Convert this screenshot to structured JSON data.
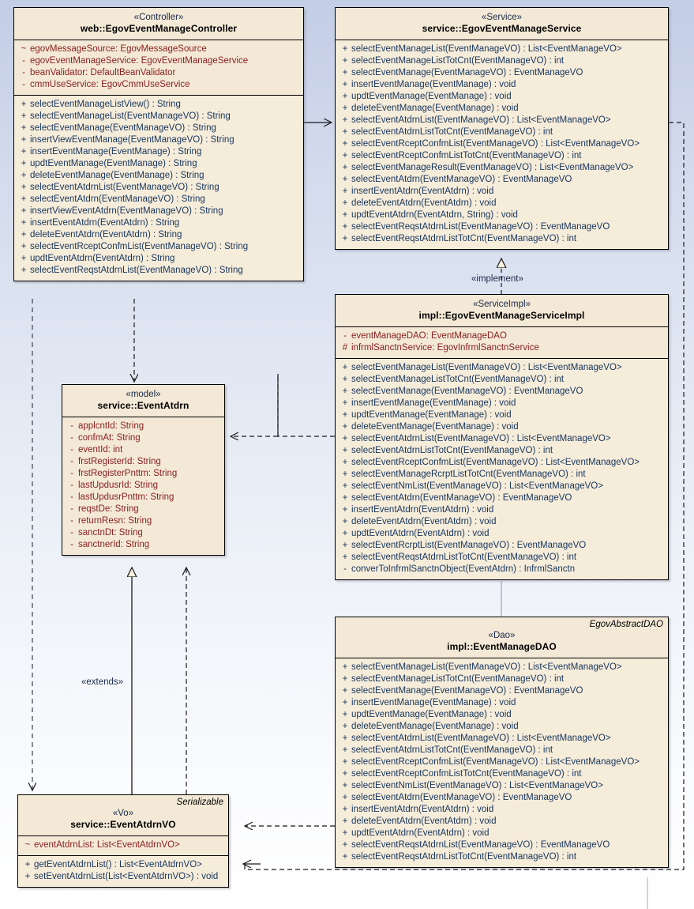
{
  "diagram": {
    "title": "Egov Event Manage UML Class Diagram",
    "background_top": "#c3cde6",
    "background_bottom": "#ffffff",
    "class_fill": "#fbf2e0",
    "attr_color": "#8a2020",
    "op_color": "#16355c"
  },
  "classes": {
    "controller": {
      "stereotype": "«Controller»",
      "name": "web::EgovEventManageController",
      "attributes": [
        {
          "vis": "~",
          "text": "egovMessageSource:  EgovMessageSource"
        },
        {
          "vis": "-",
          "text": "egovEventManageService:  EgovEventManageService"
        },
        {
          "vis": "-",
          "text": "beanValidator:  DefaultBeanValidator"
        },
        {
          "vis": "-",
          "text": "cmmUseService:  EgovCmmUseService"
        }
      ],
      "operations": [
        {
          "vis": "+",
          "text": "selectEventManageListView() : String"
        },
        {
          "vis": "+",
          "text": "selectEventManageList(EventManageVO) : String"
        },
        {
          "vis": "+",
          "text": "selectEventManage(EventManageVO) : String"
        },
        {
          "vis": "+",
          "text": "insertViewEventManage(EventManageVO) : String"
        },
        {
          "vis": "+",
          "text": "insertEventManage(EventManage) : String"
        },
        {
          "vis": "+",
          "text": "updtEventManage(EventManage) : String"
        },
        {
          "vis": "+",
          "text": "deleteEventManage(EventManage) : String"
        },
        {
          "vis": "+",
          "text": "selectEventAtdrnList(EventManageVO) : String"
        },
        {
          "vis": "+",
          "text": "selectEventAtdrn(EventManageVO) : String"
        },
        {
          "vis": "+",
          "text": "insertViewEventAtdrn(EventManageVO) : String"
        },
        {
          "vis": "+",
          "text": "insertEventAtdrn(EventAtdrn) : String"
        },
        {
          "vis": "+",
          "text": "deleteEventAtdrn(EventAtdrn) : String"
        },
        {
          "vis": "+",
          "text": "selectEventRceptConfmList(EventManageVO) : String"
        },
        {
          "vis": "+",
          "text": "updtEventAtdrn(EventAtdrn) : String"
        },
        {
          "vis": "+",
          "text": "selectEventReqstAtdrnList(EventManageVO) : String"
        }
      ]
    },
    "service": {
      "stereotype": "«Service»",
      "name": "service::EgovEventManageService",
      "operations": [
        {
          "vis": "+",
          "text": "selectEventManageList(EventManageVO) : List<EventManageVO>"
        },
        {
          "vis": "+",
          "text": "selectEventManageListTotCnt(EventManageVO) : int"
        },
        {
          "vis": "+",
          "text": "selectEventManage(EventManageVO) : EventManageVO"
        },
        {
          "vis": "+",
          "text": "insertEventManage(EventManage) : void"
        },
        {
          "vis": "+",
          "text": "updtEventManage(EventManage) : void"
        },
        {
          "vis": "+",
          "text": "deleteEventManage(EventManage) : void"
        },
        {
          "vis": "+",
          "text": "selectEventAtdrnList(EventManageVO) : List<EventManageVO>"
        },
        {
          "vis": "+",
          "text": "selectEventAtdrnListTotCnt(EventManageVO) : int"
        },
        {
          "vis": "+",
          "text": "selectEventRceptConfmList(EventManageVO) : List<EventManageVO>"
        },
        {
          "vis": "+",
          "text": "selectEventRceptConfmListTotCnt(EventManageVO) : int"
        },
        {
          "vis": "+",
          "text": "selectEventManageResult(EventManageVO) : List<EventManageVO>"
        },
        {
          "vis": "+",
          "text": "selectEventAtdrn(EventManageVO) : EventManageVO"
        },
        {
          "vis": "+",
          "text": "insertEventAtdrn(EventAtdrn) : void"
        },
        {
          "vis": "+",
          "text": "deleteEventAtdrn(EventAtdrn) : void"
        },
        {
          "vis": "+",
          "text": "updtEventAtdrn(EventAtdrn, String) : void"
        },
        {
          "vis": "+",
          "text": "selectEventReqstAtdrnList(EventManageVO) : EventManageVO"
        },
        {
          "vis": "+",
          "text": "selectEventReqstAtdrnListTotCnt(EventManageVO) : int"
        }
      ]
    },
    "service_impl": {
      "stereotype": "«ServiceImpl»",
      "name": "impl::EgovEventManageServiceImpl",
      "attributes": [
        {
          "vis": "-",
          "text": "eventManageDAO:  EventManageDAO"
        },
        {
          "vis": "#",
          "text": "infrmlSanctnService:  EgovInfrmlSanctnService"
        }
      ],
      "operations": [
        {
          "vis": "+",
          "text": "selectEventManageList(EventManageVO) : List<EventManageVO>"
        },
        {
          "vis": "+",
          "text": "selectEventManageListTotCnt(EventManageVO) : int"
        },
        {
          "vis": "+",
          "text": "selectEventManage(EventManageVO) : EventManageVO"
        },
        {
          "vis": "+",
          "text": "insertEventManage(EventManage) : void"
        },
        {
          "vis": "+",
          "text": "updtEventManage(EventManage) : void"
        },
        {
          "vis": "+",
          "text": "deleteEventManage(EventManage) : void"
        },
        {
          "vis": "+",
          "text": "selectEventAtdrnList(EventManageVO) : List<EventManageVO>"
        },
        {
          "vis": "+",
          "text": "selectEventAtdrnListTotCnt(EventManageVO) : int"
        },
        {
          "vis": "+",
          "text": "selectEventRceptConfmList(EventManageVO) : List<EventManageVO>"
        },
        {
          "vis": "+",
          "text": "selectEventManageRcrptListTotCnt(EventManageVO) : int"
        },
        {
          "vis": "+",
          "text": "selectEventNmList(EventManageVO) : List<EventManageVO>"
        },
        {
          "vis": "+",
          "text": "selectEventAtdrn(EventManageVO) : EventManageVO"
        },
        {
          "vis": "+",
          "text": "insertEventAtdrn(EventAtdrn) : void"
        },
        {
          "vis": "+",
          "text": "deleteEventAtdrn(EventAtdrn) : void"
        },
        {
          "vis": "+",
          "text": "updtEventAtdrn(EventAtdrn) : void"
        },
        {
          "vis": "+",
          "text": "selectEventRcrptList(EventManageVO) : EventManageVO"
        },
        {
          "vis": "+",
          "text": "selectEventReqstAtdrnListTotCnt(EventManageVO) : int"
        },
        {
          "vis": "-",
          "text": "converToInfrmlSanctnObject(EventAtdrn) : InfrmlSanctn"
        }
      ]
    },
    "dao": {
      "extends_tag": "EgovAbstractDAO",
      "stereotype": "«Dao»",
      "name": "impl::EventManageDAO",
      "operations": [
        {
          "vis": "+",
          "text": "selectEventManageList(EventManageVO) : List<EventManageVO>"
        },
        {
          "vis": "+",
          "text": "selectEventManageListTotCnt(EventManageVO) : int"
        },
        {
          "vis": "+",
          "text": "selectEventManage(EventManageVO) : EventManageVO"
        },
        {
          "vis": "+",
          "text": "insertEventManage(EventManage) : void"
        },
        {
          "vis": "+",
          "text": "updtEventManage(EventManage) : void"
        },
        {
          "vis": "+",
          "text": "deleteEventManage(EventManage) : void"
        },
        {
          "vis": "+",
          "text": "selectEventAtdrnList(EventManageVO) : List<EventManageVO>"
        },
        {
          "vis": "+",
          "text": "selectEventAtdrnListTotCnt(EventManageVO) : int"
        },
        {
          "vis": "+",
          "text": "selectEventRceptConfmList(EventManageVO) : List<EventManageVO>"
        },
        {
          "vis": "+",
          "text": "selectEventRceptConfmListTotCnt(EventManageVO) : int"
        },
        {
          "vis": "+",
          "text": "selectEventNmList(EventManageVO) : List<EventManageVO>"
        },
        {
          "vis": "+",
          "text": "selectEventAtdrn(EventManageVO) : EventManageVO"
        },
        {
          "vis": "+",
          "text": "insertEventAtdrn(EventAtdrn) : void"
        },
        {
          "vis": "+",
          "text": "deleteEventAtdrn(EventAtdrn) : void"
        },
        {
          "vis": "+",
          "text": "updtEventAtdrn(EventAtdrn) : void"
        },
        {
          "vis": "+",
          "text": "selectEventReqstAtdrnList(EventManageVO) : EventManageVO"
        },
        {
          "vis": "+",
          "text": "selectEventReqstAtdrnListTotCnt(EventManageVO) : int"
        }
      ]
    },
    "model": {
      "stereotype": "«model»",
      "name": "service::EventAtdrn",
      "attributes": [
        {
          "vis": "-",
          "text": "applcntId:  String"
        },
        {
          "vis": "-",
          "text": "confmAt:  String"
        },
        {
          "vis": "-",
          "text": "eventId:  int"
        },
        {
          "vis": "-",
          "text": "frstRegisterId:  String"
        },
        {
          "vis": "-",
          "text": "frstRegisterPnttm:  String"
        },
        {
          "vis": "-",
          "text": "lastUpdusrId:  String"
        },
        {
          "vis": "-",
          "text": "lastUpdusrPnttm:  String"
        },
        {
          "vis": "-",
          "text": "reqstDe:  String"
        },
        {
          "vis": "-",
          "text": "returnResn:  String"
        },
        {
          "vis": "-",
          "text": "sanctnDt:  String"
        },
        {
          "vis": "-",
          "text": "sanctnerId:  String"
        }
      ]
    },
    "vo": {
      "extends_tag": "Serializable",
      "stereotype": "«Vo»",
      "name": "service::EventAtdrnVO",
      "attributes": [
        {
          "vis": "~",
          "text": "eventAtdrnList:  List<EventAtdrnVO>"
        }
      ],
      "operations": [
        {
          "vis": "+",
          "text": "getEventAtdrnList() : List<EventAtdrnVO>"
        },
        {
          "vis": "+",
          "text": "setEventAtdrnList(List<EventAtdrnVO>) : void"
        }
      ]
    }
  },
  "edges": {
    "implement_label": "«implement»",
    "extends_label": "«extends»"
  }
}
